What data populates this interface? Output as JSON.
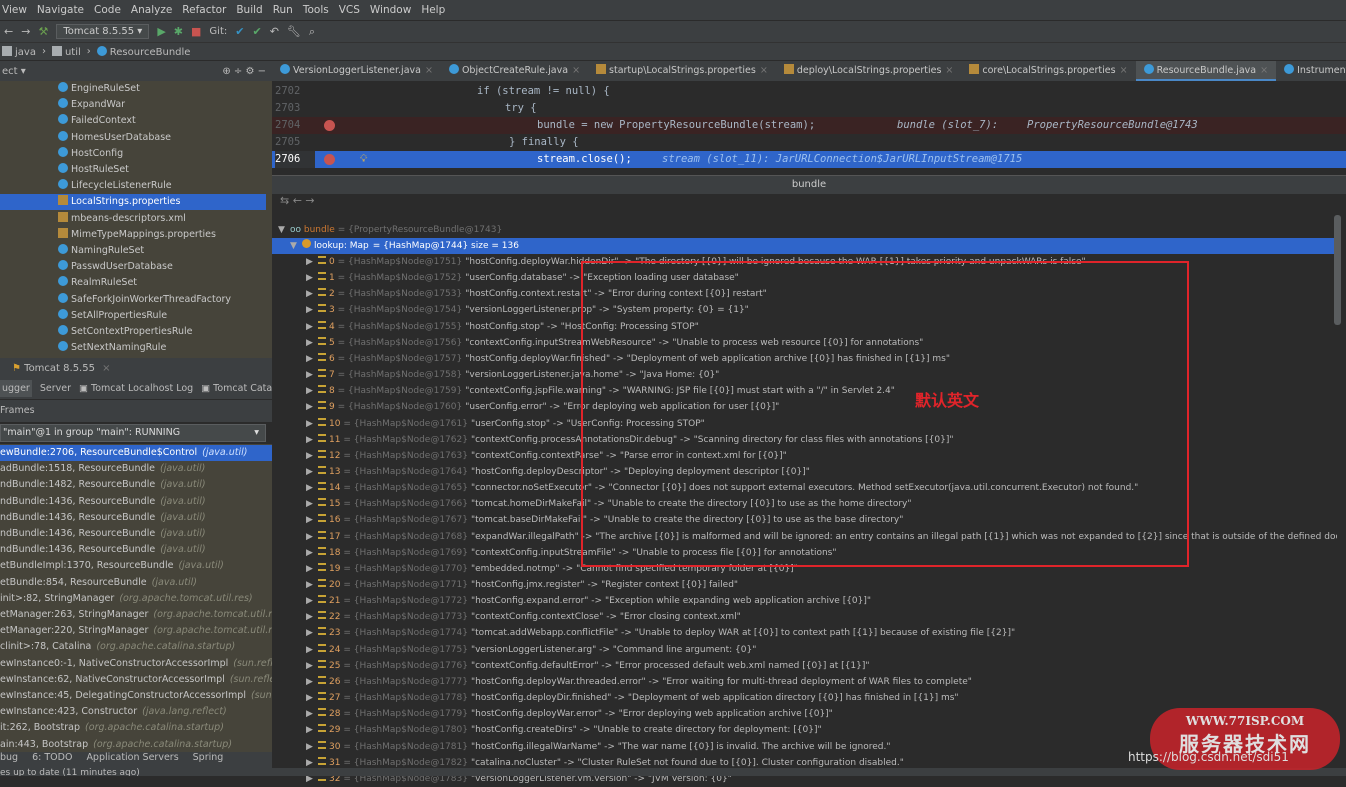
{
  "menu": [
    "View",
    "Navigate",
    "Code",
    "Analyze",
    "Refactor",
    "Build",
    "Run",
    "Tools",
    "VCS",
    "Window",
    "Help"
  ],
  "toolbar": {
    "run_config": "Tomcat 8.5.55",
    "git_label": "Git:"
  },
  "breadcrumb": [
    "java",
    "util",
    "ResourceBundle"
  ],
  "project": {
    "header": "ect ▾",
    "items": [
      {
        "label": "EngineRuleSet",
        "type": "class"
      },
      {
        "label": "ExpandWar",
        "type": "class"
      },
      {
        "label": "FailedContext",
        "type": "class"
      },
      {
        "label": "HomesUserDatabase",
        "type": "class"
      },
      {
        "label": "HostConfig",
        "type": "class"
      },
      {
        "label": "HostRuleSet",
        "type": "class"
      },
      {
        "label": "LifecycleListenerRule",
        "type": "class"
      },
      {
        "label": "LocalStrings.properties",
        "type": "properties",
        "selected": true
      },
      {
        "label": "mbeans-descriptors.xml",
        "type": "xml"
      },
      {
        "label": "MimeTypeMappings.properties",
        "type": "properties"
      },
      {
        "label": "NamingRuleSet",
        "type": "class"
      },
      {
        "label": "PasswdUserDatabase",
        "type": "class"
      },
      {
        "label": "RealmRuleSet",
        "type": "class"
      },
      {
        "label": "SafeForkJoinWorkerThreadFactory",
        "type": "class"
      },
      {
        "label": "SetAllPropertiesRule",
        "type": "class"
      },
      {
        "label": "SetContextPropertiesRule",
        "type": "class"
      },
      {
        "label": "SetNextNamingRule",
        "type": "class"
      }
    ]
  },
  "editor_tabs": [
    {
      "label": "VersionLoggerListener.java"
    },
    {
      "label": "ObjectCreateRule.java"
    },
    {
      "label": "startup\\LocalStrings.properties"
    },
    {
      "label": "deploy\\LocalStrings.properties"
    },
    {
      "label": "core\\LocalStrings.properties"
    },
    {
      "label": "ResourceBundle.java",
      "active": true
    },
    {
      "label": "InstrumentationImpl.clas"
    }
  ],
  "code": {
    "lines": [
      {
        "num": "2702",
        "text": "if (stream != null) {"
      },
      {
        "num": "2703",
        "text": "try {"
      },
      {
        "num": "2704",
        "text": "bundle = new PropertyResourceBundle(stream);",
        "hint": "bundle (slot_7): ",
        "hint_val": "PropertyResourceBundle@1743"
      },
      {
        "num": "2705",
        "text": "} finally {"
      },
      {
        "num": "2706",
        "text": "stream.close();",
        "hint": "stream (slot_11): JarURLConnection$JarURLInputStream@1715"
      }
    ]
  },
  "popup": {
    "title": "bundle",
    "root": {
      "name": "bundle",
      "value": "= {PropertyResourceBundle@1743}"
    },
    "lookup": {
      "label": "lookup: Map",
      "value": "= {HashMap@1744}  size = 136"
    },
    "entries": [
      {
        "i": "0",
        "node": "{HashMap$Node@1751}",
        "k": "\"hostConfig.deployWar.hiddenDir\"",
        "v": "\"The directory [{0}] will be ignored because the WAR [{1}] takes priority and unpackWARs is false\""
      },
      {
        "i": "1",
        "node": "{HashMap$Node@1752}",
        "k": "\"userConfig.database\"",
        "v": "\"Exception loading user database\""
      },
      {
        "i": "2",
        "node": "{HashMap$Node@1753}",
        "k": "\"hostConfig.context.restart\"",
        "v": "\"Error during context [{0}] restart\""
      },
      {
        "i": "3",
        "node": "{HashMap$Node@1754}",
        "k": "\"versionLoggerListener.prop\"",
        "v": "\"System property:       {0} = {1}\""
      },
      {
        "i": "4",
        "node": "{HashMap$Node@1755}",
        "k": "\"hostConfig.stop\"",
        "v": "\"HostConfig: Processing STOP\""
      },
      {
        "i": "5",
        "node": "{HashMap$Node@1756}",
        "k": "\"contextConfig.inputStreamWebResource\"",
        "v": "\"Unable to process web resource [{0}] for annotations\""
      },
      {
        "i": "6",
        "node": "{HashMap$Node@1757}",
        "k": "\"hostConfig.deployWar.finished\"",
        "v": "\"Deployment of web application archive [{0}] has finished in [{1}] ms\""
      },
      {
        "i": "7",
        "node": "{HashMap$Node@1758}",
        "k": "\"versionLoggerListener.java.home\"",
        "v": "\"Java Home:             {0}\""
      },
      {
        "i": "8",
        "node": "{HashMap$Node@1759}",
        "k": "\"contextConfig.jspFile.warning\"",
        "v": "\"WARNING: JSP file [{0}] must start with a \"/\" in Servlet 2.4\""
      },
      {
        "i": "9",
        "node": "{HashMap$Node@1760}",
        "k": "\"userConfig.error\"",
        "v": "\"Error deploying web application for user [{0}]\""
      },
      {
        "i": "10",
        "node": "{HashMap$Node@1761}",
        "k": "\"userConfig.stop\"",
        "v": "\"UserConfig: Processing STOP\""
      },
      {
        "i": "11",
        "node": "{HashMap$Node@1762}",
        "k": "\"contextConfig.processAnnotationsDir.debug\"",
        "v": "\"Scanning directory for class files with annotations [{0}]\""
      },
      {
        "i": "12",
        "node": "{HashMap$Node@1763}",
        "k": "\"contextConfig.contextParse\"",
        "v": "\"Parse error in context.xml for [{0}]\""
      },
      {
        "i": "13",
        "node": "{HashMap$Node@1764}",
        "k": "\"hostConfig.deployDescriptor\"",
        "v": "\"Deploying deployment descriptor [{0}]\""
      },
      {
        "i": "14",
        "node": "{HashMap$Node@1765}",
        "k": "\"connector.noSetExecutor\"",
        "v": "\"Connector [{0}] does not support external executors. Method setExecutor(java.util.concurrent.Executor) not found.\""
      },
      {
        "i": "15",
        "node": "{HashMap$Node@1766}",
        "k": "\"tomcat.homeDirMakeFail\"",
        "v": "\"Unable to create the directory [{0}] to use as the home directory\""
      },
      {
        "i": "16",
        "node": "{HashMap$Node@1767}",
        "k": "\"tomcat.baseDirMakeFail\"",
        "v": "\"Unable to create the directory [{0}] to use as the base directory\""
      },
      {
        "i": "17",
        "node": "{HashMap$Node@1768}",
        "k": "\"expandWar.illegalPath\"",
        "v": "\"The archive [{0}] is malformed and will be ignored: an entry contains an illegal path [{1}] which was not expanded to [{2}] since that is outside of the defined docBase ["
      },
      {
        "i": "18",
        "node": "{HashMap$Node@1769}",
        "k": "\"contextConfig.inputStreamFile\"",
        "v": "\"Unable to process file [{0}] for annotations\""
      },
      {
        "i": "19",
        "node": "{HashMap$Node@1770}",
        "k": "\"embedded.notmp\"",
        "v": "\"Cannot find specified temporary folder at [{0}]\""
      },
      {
        "i": "20",
        "node": "{HashMap$Node@1771}",
        "k": "\"hostConfig.jmx.register\"",
        "v": "\"Register context [{0}] failed\""
      },
      {
        "i": "21",
        "node": "{HashMap$Node@1772}",
        "k": "\"hostConfig.expand.error\"",
        "v": "\"Exception while expanding web application archive [{0}]\""
      },
      {
        "i": "22",
        "node": "{HashMap$Node@1773}",
        "k": "\"contextConfig.contextClose\"",
        "v": "\"Error closing context.xml\""
      },
      {
        "i": "23",
        "node": "{HashMap$Node@1774}",
        "k": "\"tomcat.addWebapp.conflictFile\"",
        "v": "\"Unable to deploy WAR at [{0}] to context path [{1}] because of existing file [{2}]\""
      },
      {
        "i": "24",
        "node": "{HashMap$Node@1775}",
        "k": "\"versionLoggerListener.arg\"",
        "v": "\"Command line argument: {0}\""
      },
      {
        "i": "25",
        "node": "{HashMap$Node@1776}",
        "k": "\"contextConfig.defaultError\"",
        "v": "\"Error processed default web.xml named [{0}] at [{1}]\""
      },
      {
        "i": "26",
        "node": "{HashMap$Node@1777}",
        "k": "\"hostConfig.deployWar.threaded.error\"",
        "v": "\"Error waiting for multi-thread deployment of WAR files to complete\""
      },
      {
        "i": "27",
        "node": "{HashMap$Node@1778}",
        "k": "\"hostConfig.deployDir.finished\"",
        "v": "\"Deployment of web application directory [{0}] has finished in [{1}] ms\""
      },
      {
        "i": "28",
        "node": "{HashMap$Node@1779}",
        "k": "\"hostConfig.deployWar.error\"",
        "v": "\"Error deploying web application archive [{0}]\""
      },
      {
        "i": "29",
        "node": "{HashMap$Node@1780}",
        "k": "\"hostConfig.createDirs\"",
        "v": "\"Unable to create directory for deployment: [{0}]\""
      },
      {
        "i": "30",
        "node": "{HashMap$Node@1781}",
        "k": "\"hostConfig.illegalWarName\"",
        "v": "\"The war name [{0}] is invalid. The archive will be ignored.\""
      },
      {
        "i": "31",
        "node": "{HashMap$Node@1782}",
        "k": "\"catalina.noCluster\"",
        "v": "\"Cluster RuleSet not found due to [{0}]. Cluster configuration disabled.\""
      },
      {
        "i": "32",
        "node": "{HashMap$Node@1783}",
        "k": "\"versionLoggerListener.vm.version\"",
        "v": "\"JVM Version:           {0}\""
      }
    ]
  },
  "annotation": "默认英文",
  "run_tab": "Tomcat 8.5.55",
  "debug_tabs": [
    "ugger",
    "Server",
    "Tomcat Localhost Log",
    "Tomcat Catal"
  ],
  "frames_header": "Frames",
  "thread": "\"main\"@1 in group \"main\": RUNNING",
  "frames": [
    {
      "m": "ewBundle:2706, ResourceBundle$Control",
      "p": "(java.util)",
      "selected": true
    },
    {
      "m": "adBundle:1518, ResourceBundle",
      "p": "(java.util)"
    },
    {
      "m": "ndBundle:1482, ResourceBundle",
      "p": "(java.util)"
    },
    {
      "m": "ndBundle:1436, ResourceBundle",
      "p": "(java.util)"
    },
    {
      "m": "ndBundle:1436, ResourceBundle",
      "p": "(java.util)"
    },
    {
      "m": "ndBundle:1436, ResourceBundle",
      "p": "(java.util)"
    },
    {
      "m": "ndBundle:1436, ResourceBundle",
      "p": "(java.util)"
    },
    {
      "m": "etBundleImpl:1370, ResourceBundle",
      "p": "(java.util)"
    },
    {
      "m": "etBundle:854, ResourceBundle",
      "p": "(java.util)"
    },
    {
      "m": "init>:82, StringManager",
      "p": "(org.apache.tomcat.util.res)"
    },
    {
      "m": "etManager:263, StringManager",
      "p": "(org.apache.tomcat.util.res)"
    },
    {
      "m": "etManager:220, StringManager",
      "p": "(org.apache.tomcat.util.res)"
    },
    {
      "m": "clinit>:78, Catalina",
      "p": "(org.apache.catalina.startup)"
    },
    {
      "m": "ewInstance0:-1, NativeConstructorAccessorImpl",
      "p": "(sun.reflect)"
    },
    {
      "m": "ewInstance:62, NativeConstructorAccessorImpl",
      "p": "(sun.reflect)"
    },
    {
      "m": "ewInstance:45, DelegatingConstructorAccessorImpl",
      "p": "(sun.reflec"
    },
    {
      "m": "ewInstance:423, Constructor",
      "p": "(java.lang.reflect)"
    },
    {
      "m": "it:262, Bootstrap",
      "p": "(org.apache.catalina.startup)"
    },
    {
      "m": "ain:443, Bootstrap",
      "p": "(org.apache.catalina.startup)"
    }
  ],
  "bottom_tabs": [
    "bug",
    "6: TODO",
    "Application Servers",
    "Spring"
  ],
  "status": "es up to date (11 minutes ago)",
  "watermark": {
    "line1": "WWW.77ISP.COM",
    "line2": "服务器技术网",
    "url": "https://blog.csdn.net/sdi51"
  },
  "colors": {
    "selection": "#2f65ca",
    "annotation_red": "#e0242a",
    "breakpoint": "#c75450"
  }
}
